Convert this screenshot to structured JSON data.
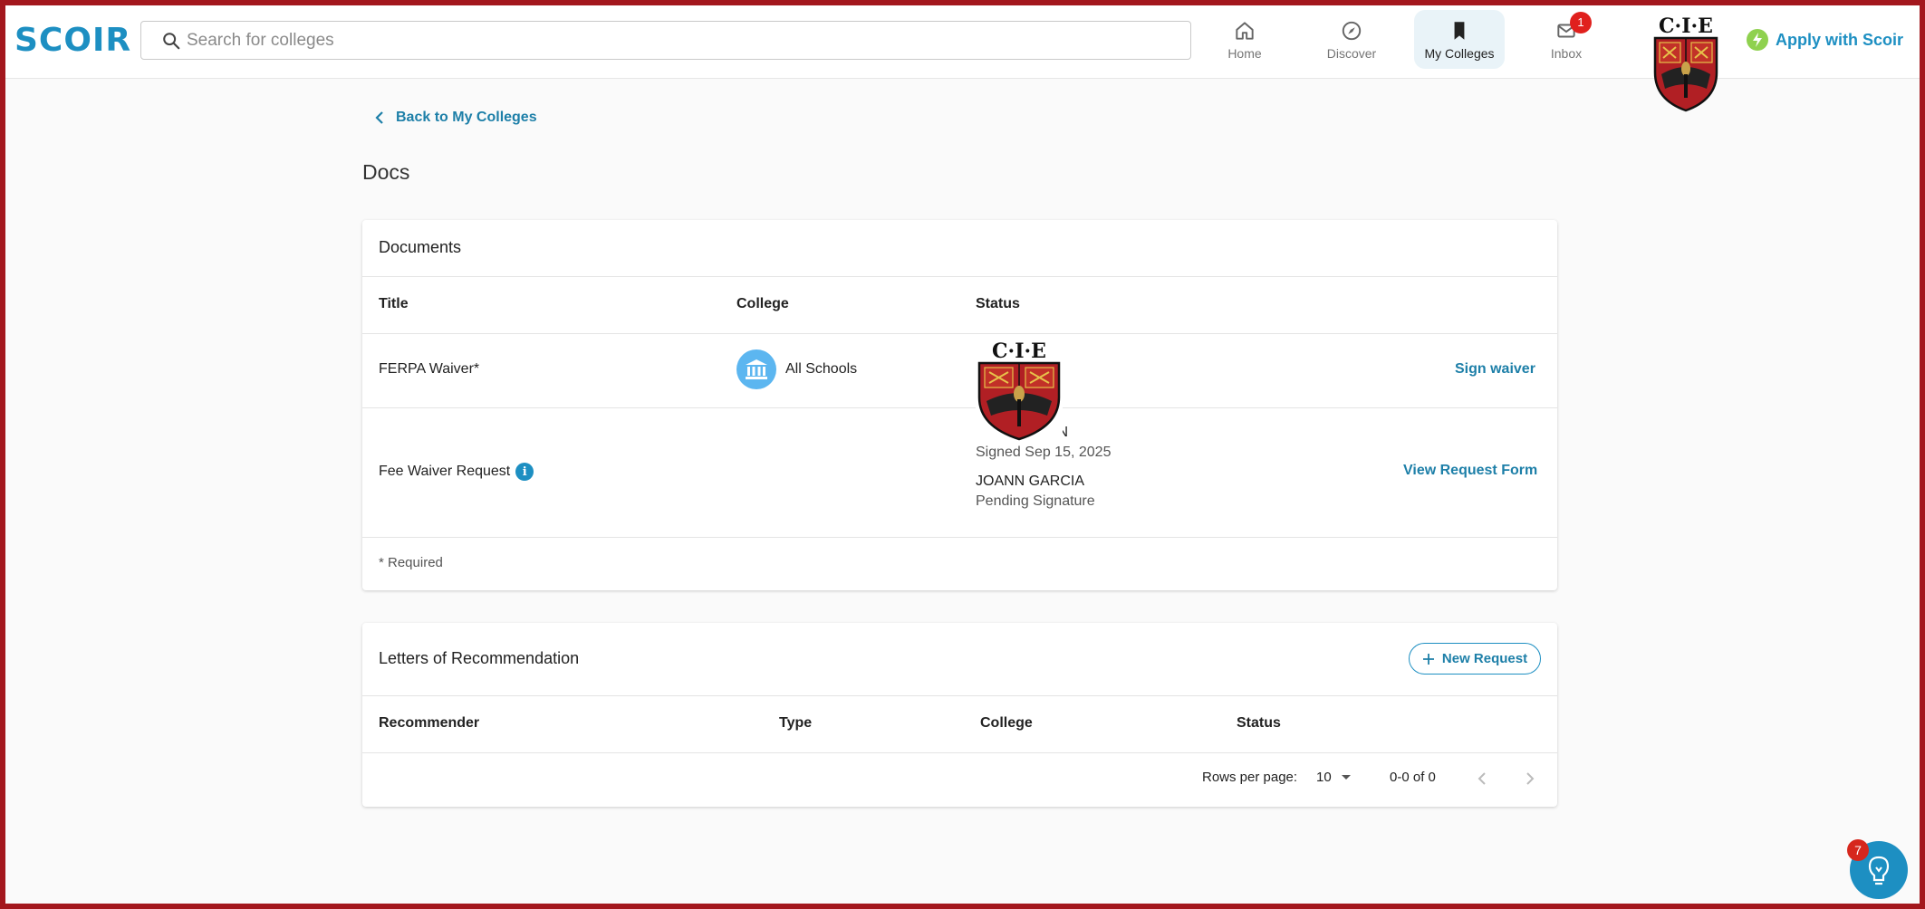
{
  "header": {
    "logo_text": "SCOIR",
    "search_placeholder": "Search for colleges",
    "nav": [
      {
        "label": "Home",
        "icon": "home-icon"
      },
      {
        "label": "Discover",
        "icon": "compass-icon"
      },
      {
        "label": "My Colleges",
        "icon": "bookmark-icon",
        "active": true
      },
      {
        "label": "Inbox",
        "icon": "mail-icon",
        "badge": "1"
      }
    ],
    "apply_label": "Apply with Scoir"
  },
  "logo_overlay_text": "C·I·E",
  "back_link": "Back to My Colleges",
  "page_title": "Docs",
  "documents": {
    "title": "Documents",
    "columns": [
      "Title",
      "College",
      "Status"
    ],
    "rows": [
      {
        "title": "FERPA Waiver*",
        "college": "All Schools",
        "action": "Sign waiver"
      },
      {
        "title": "Fee Waiver Request",
        "status_name_1_visible": "ON",
        "status_line_1": "Signed Sep 15, 2025",
        "status_name_2": "JOANN GARCIA",
        "status_line_2": "Pending Signature",
        "action": "View Request Form"
      }
    ],
    "footnote": "* Required"
  },
  "letters": {
    "title": "Letters of Recommendation",
    "new_request_label": "New Request",
    "columns": [
      "Recommender",
      "Type",
      "College",
      "Status"
    ],
    "pagination": {
      "rows_per_page_label": "Rows per page:",
      "rows_per_page_value": "10",
      "range": "0-0 of 0"
    }
  },
  "help_badge": "7",
  "colors": {
    "accent": "#1d8fc2",
    "frame": "#a3171d",
    "badge": "#e0201d"
  }
}
